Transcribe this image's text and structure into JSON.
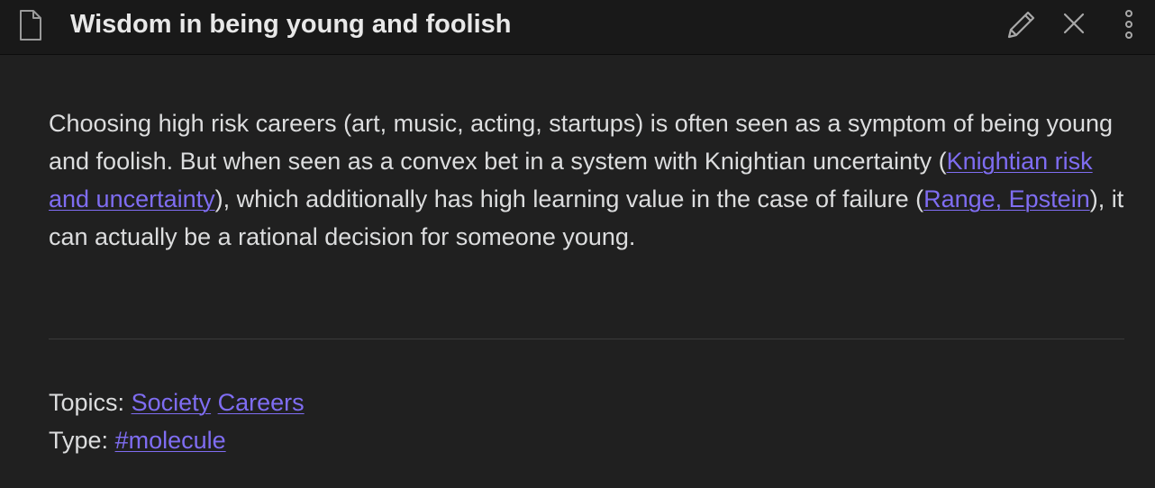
{
  "header": {
    "title": "Wisdom in being young and foolish",
    "icons": {
      "file": "file-icon",
      "edit": "pencil-icon",
      "close": "close-icon",
      "more": "more-vertical-icon"
    }
  },
  "body": {
    "text_1": "Choosing high risk careers (art, music, acting, startups) is often seen as a symptom of being young and foolish. But when seen as a convex bet in a system with Knightian uncertainty (",
    "link_1": "Knightian risk and uncertainty",
    "text_2": "), which additionally has high learning value in the case of failure (",
    "link_2": "Range, Epstein",
    "text_3": "), it can actually be a rational decision for someone young."
  },
  "meta": {
    "topics_label": "Topics:",
    "topics": [
      "Society",
      "Careers"
    ],
    "type_label": "Type:",
    "type_value": "#molecule"
  },
  "colors": {
    "background": "#202020",
    "header_background": "#191919",
    "text": "#dcddde",
    "link": "#7f6df2"
  }
}
